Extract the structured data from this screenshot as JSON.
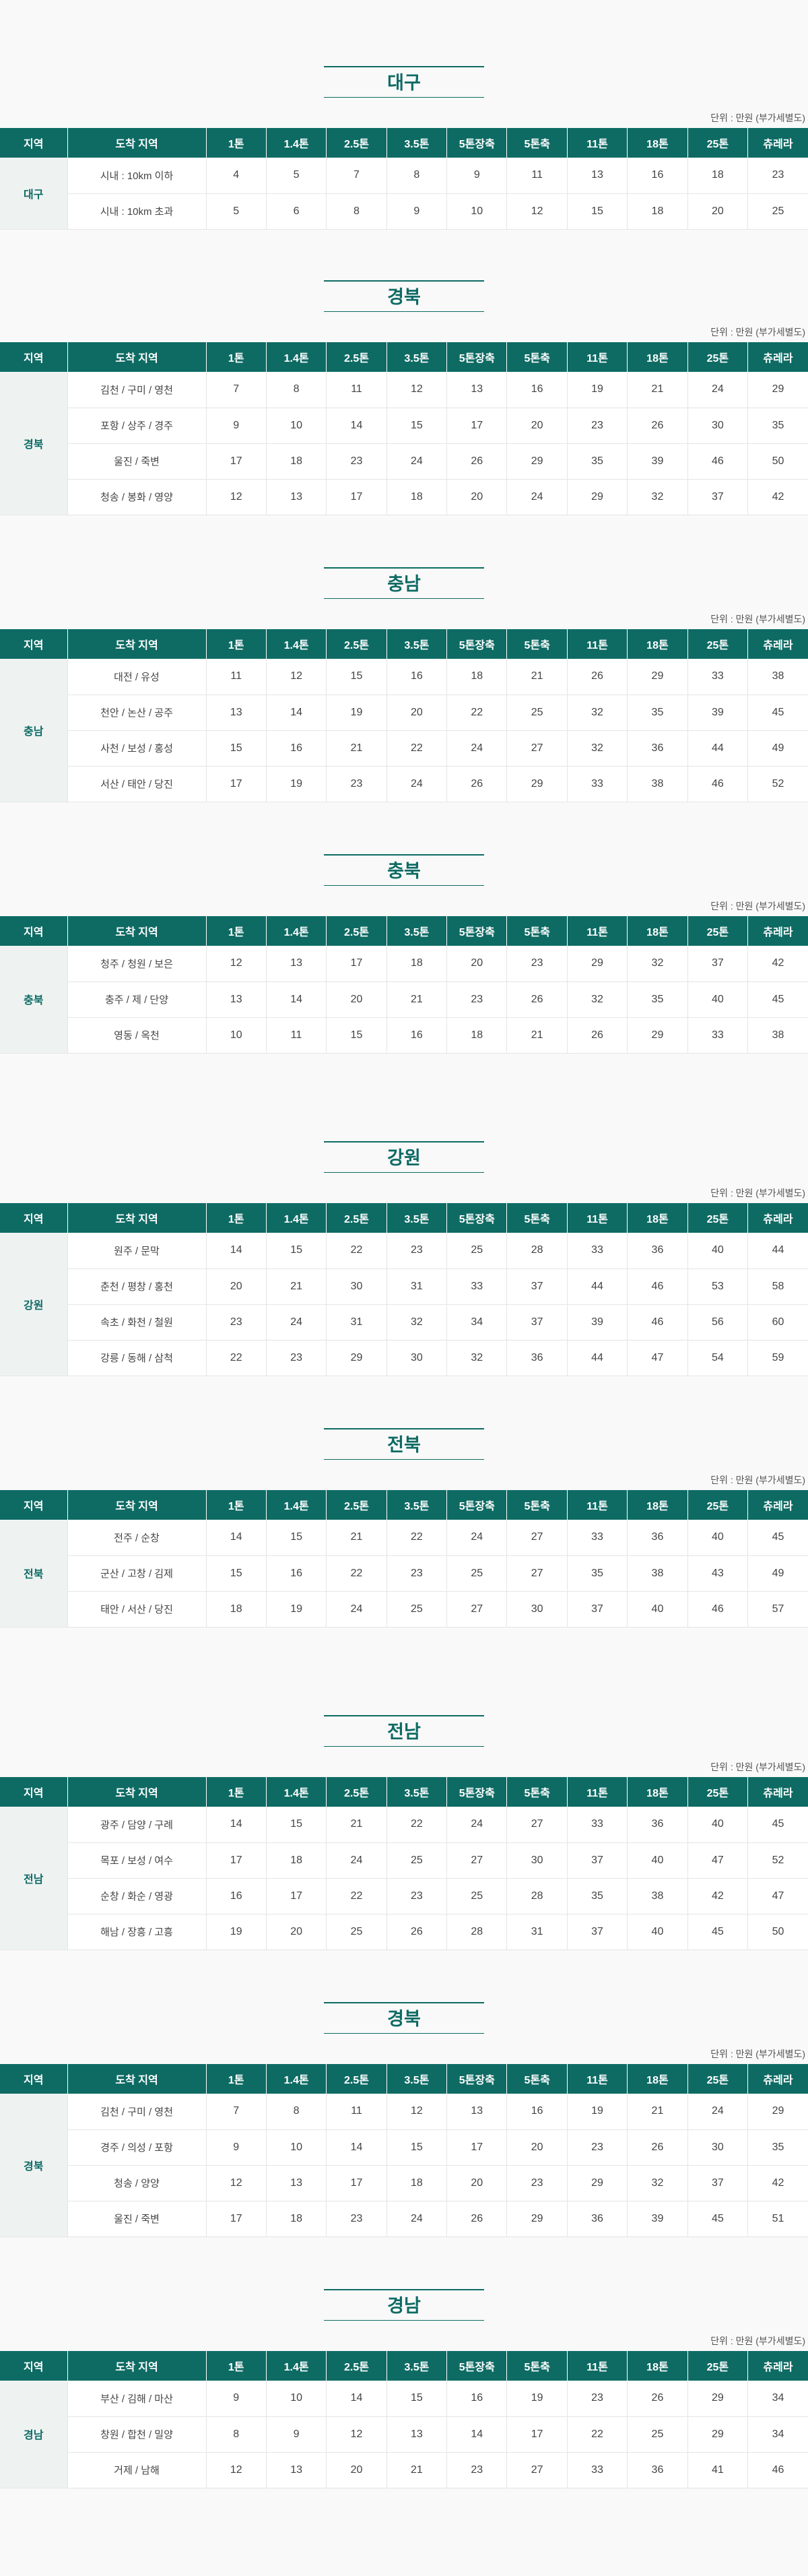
{
  "unit_label": "단위 : 만원 (부가세별도)",
  "headers": [
    "지역",
    "도착 지역",
    "1톤",
    "1.4톤",
    "2.5톤",
    "3.5톤",
    "5톤장축",
    "5톤축",
    "11톤",
    "18톤",
    "25톤",
    "츄레라"
  ],
  "sections": [
    {
      "title": "대구",
      "region": "대구",
      "rows": [
        {
          "dest": "시내 : 10km 이하",
          "values": [
            "4",
            "5",
            "7",
            "8",
            "9",
            "11",
            "13",
            "16",
            "18",
            "23"
          ]
        },
        {
          "dest": "시내 : 10km 초과",
          "values": [
            "5",
            "6",
            "8",
            "9",
            "10",
            "12",
            "15",
            "18",
            "20",
            "25"
          ]
        }
      ]
    },
    {
      "title": "경북",
      "region": "경북",
      "rows": [
        {
          "dest": "김천 / 구미 / 영천",
          "values": [
            "7",
            "8",
            "11",
            "12",
            "13",
            "16",
            "19",
            "21",
            "24",
            "29"
          ]
        },
        {
          "dest": "포항 / 상주 / 경주",
          "values": [
            "9",
            "10",
            "14",
            "15",
            "17",
            "20",
            "23",
            "26",
            "30",
            "35"
          ]
        },
        {
          "dest": "울진 / 죽변",
          "values": [
            "17",
            "18",
            "23",
            "24",
            "26",
            "29",
            "35",
            "39",
            "46",
            "50"
          ]
        },
        {
          "dest": "청송 / 봉화 / 영양",
          "values": [
            "12",
            "13",
            "17",
            "18",
            "20",
            "24",
            "29",
            "32",
            "37",
            "42"
          ]
        }
      ]
    },
    {
      "title": "충남",
      "region": "충남",
      "rows": [
        {
          "dest": "대전 / 유성",
          "values": [
            "11",
            "12",
            "15",
            "16",
            "18",
            "21",
            "26",
            "29",
            "33",
            "38"
          ]
        },
        {
          "dest": "천안 / 논산 / 공주",
          "values": [
            "13",
            "14",
            "19",
            "20",
            "22",
            "25",
            "32",
            "35",
            "39",
            "45"
          ]
        },
        {
          "dest": "사천 / 보성 / 홍성",
          "values": [
            "15",
            "16",
            "21",
            "22",
            "24",
            "27",
            "32",
            "36",
            "44",
            "49"
          ]
        },
        {
          "dest": "서산 / 태안 / 당진",
          "values": [
            "17",
            "19",
            "23",
            "24",
            "26",
            "29",
            "33",
            "38",
            "46",
            "52"
          ]
        }
      ]
    },
    {
      "title": "충북",
      "region": "충북",
      "rows": [
        {
          "dest": "청주 / 청원 / 보은",
          "values": [
            "12",
            "13",
            "17",
            "18",
            "20",
            "23",
            "29",
            "32",
            "37",
            "42"
          ]
        },
        {
          "dest": "충주 / 제 / 단양",
          "values": [
            "13",
            "14",
            "20",
            "21",
            "23",
            "26",
            "32",
            "35",
            "40",
            "45"
          ]
        },
        {
          "dest": "영동 / 옥천",
          "values": [
            "10",
            "11",
            "15",
            "16",
            "18",
            "21",
            "26",
            "29",
            "33",
            "38"
          ]
        }
      ]
    },
    {
      "title": "강원",
      "region": "강원",
      "rows": [
        {
          "dest": "원주 / 문막",
          "values": [
            "14",
            "15",
            "22",
            "23",
            "25",
            "28",
            "33",
            "36",
            "40",
            "44"
          ]
        },
        {
          "dest": "춘천 / 평창 / 홍천",
          "values": [
            "20",
            "21",
            "30",
            "31",
            "33",
            "37",
            "44",
            "46",
            "53",
            "58"
          ]
        },
        {
          "dest": "속초 / 화천 / 철원",
          "values": [
            "23",
            "24",
            "31",
            "32",
            "34",
            "37",
            "39",
            "46",
            "56",
            "60"
          ]
        },
        {
          "dest": "강릉 / 동해 / 삼척",
          "values": [
            "22",
            "23",
            "29",
            "30",
            "32",
            "36",
            "44",
            "47",
            "54",
            "59"
          ]
        }
      ]
    },
    {
      "title": "전북",
      "region": "전북",
      "rows": [
        {
          "dest": "전주 / 순창",
          "values": [
            "14",
            "15",
            "21",
            "22",
            "24",
            "27",
            "33",
            "36",
            "40",
            "45"
          ]
        },
        {
          "dest": "군산 / 고창 / 김제",
          "values": [
            "15",
            "16",
            "22",
            "23",
            "25",
            "27",
            "35",
            "38",
            "43",
            "49"
          ]
        },
        {
          "dest": "태안 / 서산 / 당진",
          "values": [
            "18",
            "19",
            "24",
            "25",
            "27",
            "30",
            "37",
            "40",
            "46",
            "57"
          ]
        }
      ]
    },
    {
      "title": "전남",
      "region": "전남",
      "rows": [
        {
          "dest": "광주 / 담양 / 구례",
          "values": [
            "14",
            "15",
            "21",
            "22",
            "24",
            "27",
            "33",
            "36",
            "40",
            "45"
          ]
        },
        {
          "dest": "목포 / 보성 / 여수",
          "values": [
            "17",
            "18",
            "24",
            "25",
            "27",
            "30",
            "37",
            "40",
            "47",
            "52"
          ]
        },
        {
          "dest": "순창 / 화순 / 영광",
          "values": [
            "16",
            "17",
            "22",
            "23",
            "25",
            "28",
            "35",
            "38",
            "42",
            "47"
          ]
        },
        {
          "dest": "해남 / 장흥 / 고흥",
          "values": [
            "19",
            "20",
            "25",
            "26",
            "28",
            "31",
            "37",
            "40",
            "45",
            "50"
          ]
        }
      ]
    },
    {
      "title": "경북",
      "region": "경북",
      "rows": [
        {
          "dest": "김천 / 구미 / 영천",
          "values": [
            "7",
            "8",
            "11",
            "12",
            "13",
            "16",
            "19",
            "21",
            "24",
            "29"
          ]
        },
        {
          "dest": "경주 / 의성 / 포항",
          "values": [
            "9",
            "10",
            "14",
            "15",
            "17",
            "20",
            "23",
            "26",
            "30",
            "35"
          ]
        },
        {
          "dest": "청송 / 양양",
          "values": [
            "12",
            "13",
            "17",
            "18",
            "20",
            "23",
            "29",
            "32",
            "37",
            "42"
          ]
        },
        {
          "dest": "울진 / 죽변",
          "values": [
            "17",
            "18",
            "23",
            "24",
            "26",
            "29",
            "36",
            "39",
            "45",
            "51"
          ]
        }
      ]
    },
    {
      "title": "경남",
      "region": "경남",
      "rows": [
        {
          "dest": "부산 / 김해 / 마산",
          "values": [
            "9",
            "10",
            "14",
            "15",
            "16",
            "19",
            "23",
            "26",
            "29",
            "34"
          ]
        },
        {
          "dest": "창원 / 합천 / 밀양",
          "values": [
            "8",
            "9",
            "12",
            "13",
            "14",
            "17",
            "22",
            "25",
            "29",
            "34"
          ]
        },
        {
          "dest": "거제 / 남해",
          "values": [
            "12",
            "13",
            "20",
            "21",
            "23",
            "27",
            "33",
            "36",
            "41",
            "46"
          ]
        }
      ]
    }
  ]
}
